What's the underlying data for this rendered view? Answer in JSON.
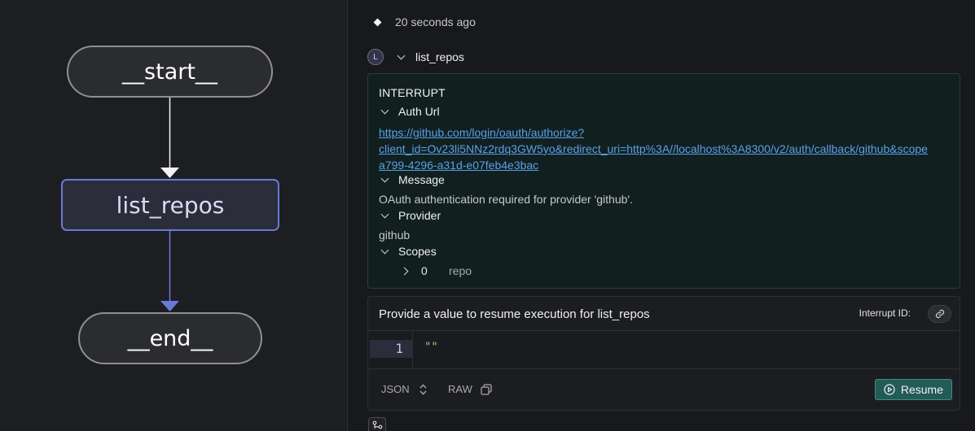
{
  "graph": {
    "nodes": {
      "start": "__start__",
      "list_repos": "list_repos",
      "end": "__end__"
    },
    "colors": {
      "edge_default": "#f2f2f2",
      "edge_active": "#6b79d6"
    }
  },
  "run": {
    "timestamp": "20 seconds ago",
    "node": {
      "avatar": "L",
      "name": "list_repos"
    },
    "interrupt": {
      "title": "INTERRUPT",
      "auth_url_label": "Auth Url",
      "auth_url_lines": [
        "https://github.com/login/oauth/authorize?",
        "client_id=Ov23li5NNz2rdq3GW5yo&redirect_uri=http%3A//localhost%3A8300/v2/auth/callback/github&scope",
        "a799-4296-a31d-e07feb4e3bac"
      ],
      "message_label": "Message",
      "message_value": "OAuth authentication required for provider 'github'.",
      "provider_label": "Provider",
      "provider_value": "github",
      "scopes_label": "Scopes",
      "scopes": [
        {
          "index": "0",
          "value": "repo"
        }
      ]
    },
    "resume": {
      "title": "Provide a value to resume execution for list_repos",
      "interrupt_id_label": "Interrupt ID:",
      "line_number": "1",
      "code": "\"\"",
      "format_json": "JSON",
      "format_raw": "RAW",
      "button_label": "Resume"
    }
  }
}
